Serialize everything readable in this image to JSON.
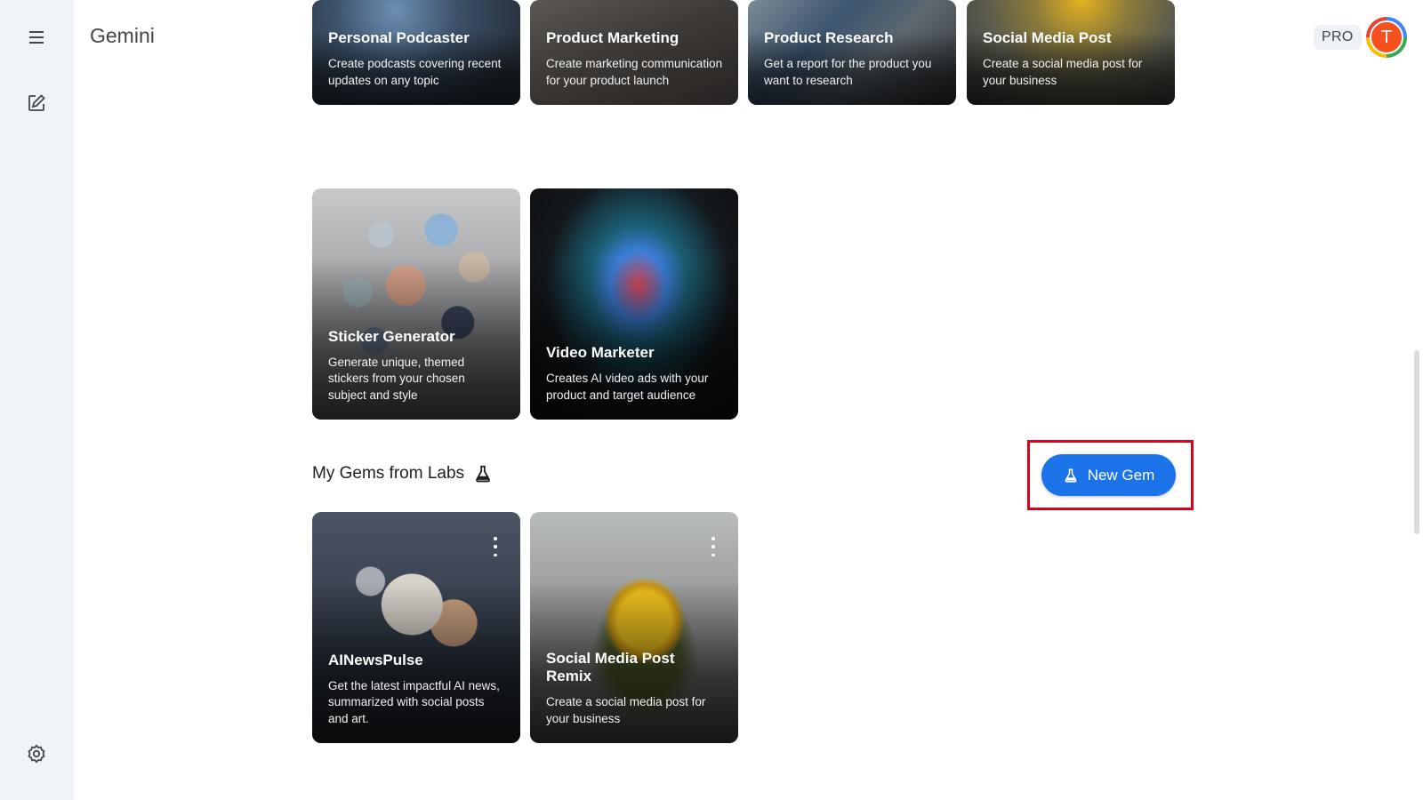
{
  "app": {
    "name": "Gemini",
    "plan_badge": "PRO",
    "avatar_initial": "T"
  },
  "rail": {
    "icons": [
      "menu-icon",
      "new-chat-icon",
      "settings-icon"
    ]
  },
  "premade_gems": [
    {
      "title": "Personal Podcaster",
      "desc": "Create podcasts covering recent updates on any topic"
    },
    {
      "title": "Product Marketing",
      "desc": "Create marketing communication for your product launch"
    },
    {
      "title": "Product Research",
      "desc": "Get a report for the product you want to research"
    },
    {
      "title": "Social Media Post",
      "desc": "Create a social media post for your business"
    },
    {
      "title": "Sticker Generator",
      "desc": "Generate unique, themed stickers from your chosen subject and style"
    },
    {
      "title": "Video Marketer",
      "desc": "Creates AI video ads with your product and target audience"
    }
  ],
  "labs_section": {
    "title": "My Gems from Labs",
    "title_icon": "flask-icon",
    "new_gem_label": "New Gem",
    "gems": [
      {
        "title": "AINewsPulse",
        "desc": "Get the latest impactful AI news, summarized with social posts and art."
      },
      {
        "title": "Social Media Post Remix",
        "desc": "Create a social media post for your business"
      }
    ]
  },
  "colors": {
    "accent": "#1a73e8",
    "highlight": "#e0001b",
    "rail_bg": "#f0f4f9",
    "avatar": "#f4511e"
  }
}
